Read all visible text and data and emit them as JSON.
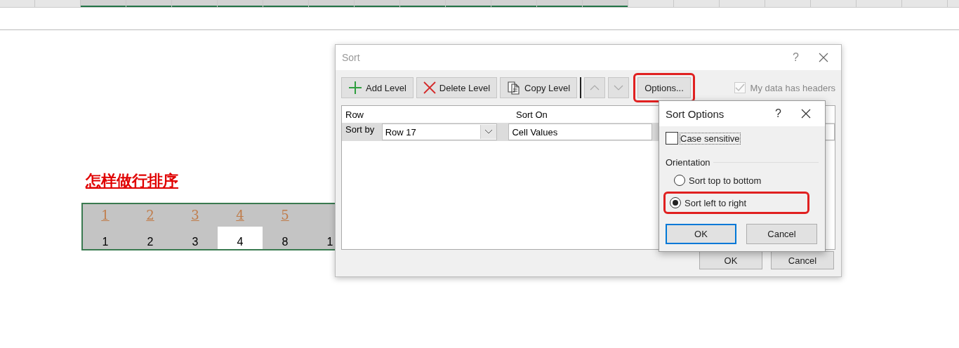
{
  "sheet": {
    "columns": [
      {
        "selected": false
      },
      {
        "selected": false
      },
      {
        "selected": true
      },
      {
        "selected": true
      },
      {
        "selected": true
      },
      {
        "selected": true
      },
      {
        "selected": true
      },
      {
        "selected": true
      },
      {
        "selected": true
      },
      {
        "selected": true
      },
      {
        "selected": true
      },
      {
        "selected": true
      },
      {
        "selected": true
      },
      {
        "selected": true
      },
      {
        "selected": false
      },
      {
        "selected": false
      },
      {
        "selected": false
      },
      {
        "selected": false
      },
      {
        "selected": false
      },
      {
        "selected": false
      },
      {
        "selected": false
      }
    ],
    "title": "怎样做行排序",
    "rows": [
      {
        "kind": "header",
        "cells": [
          {
            "text": "1",
            "selected": false
          },
          {
            "text": "2",
            "selected": false
          },
          {
            "text": "3",
            "selected": false
          },
          {
            "text": "4",
            "selected": false
          },
          {
            "text": "5",
            "selected": false
          }
        ]
      },
      {
        "kind": "value",
        "cells": [
          {
            "text": "1",
            "selected": false
          },
          {
            "text": "2",
            "selected": false
          },
          {
            "text": "3",
            "selected": false
          },
          {
            "text": "4",
            "selected": true
          },
          {
            "text": "8",
            "selected": false
          },
          {
            "text": "1",
            "selected": false
          }
        ]
      }
    ]
  },
  "sort_dialog": {
    "title": "Sort",
    "help": "?",
    "toolbar": [
      {
        "kind": "add",
        "label": "Add Level",
        "highlighted": false
      },
      {
        "kind": "delete",
        "label": "Delete Level",
        "highlighted": false
      },
      {
        "kind": "copy",
        "label": "Copy Level",
        "highlighted": false
      },
      {
        "kind": "up",
        "highlighted": false
      },
      {
        "kind": "down",
        "highlighted": false
      },
      {
        "kind": "options",
        "label": "Options...",
        "highlighted": true
      }
    ],
    "headers_checkbox": {
      "label": "My data has headers",
      "checked": true,
      "disabled": true
    },
    "columns": [
      "Row",
      "Sort On"
    ],
    "levels": [
      {
        "label": "Sort by",
        "row": "Row 17",
        "sort_on": "Cell Values"
      }
    ],
    "buttons": [
      "OK",
      "Cancel"
    ]
  },
  "options_dialog": {
    "title": "Sort Options",
    "help": "?",
    "case_sensitive": {
      "label": "Case sensitive",
      "checked": false
    },
    "orientation_label": "Orientation",
    "orientations": [
      {
        "label": "Sort top to bottom",
        "selected": false,
        "highlighted": false
      },
      {
        "label": "Sort left to right",
        "selected": true,
        "highlighted": true
      }
    ],
    "buttons": [
      "OK",
      "Cancel"
    ]
  }
}
